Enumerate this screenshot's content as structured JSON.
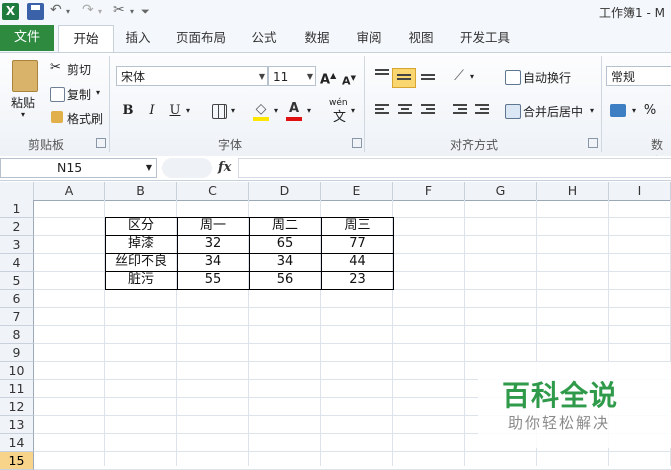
{
  "title": "工作簿1 - M",
  "quick_access": {
    "app_icon": "X",
    "save_icon": "save-icon",
    "undo_icon": "undo-icon",
    "redo_icon": "redo-icon",
    "tools_icon": "scissors-icon",
    "customize_icon": "customize-icon"
  },
  "tabs": [
    "文件",
    "开始",
    "插入",
    "页面布局",
    "公式",
    "数据",
    "审阅",
    "视图",
    "开发工具"
  ],
  "ribbon": {
    "clipboard": {
      "paste": "粘贴",
      "cut": "剪切",
      "copy": "复制",
      "format_painter": "格式刷",
      "group": "剪贴板"
    },
    "font": {
      "name": "宋体",
      "size": "11",
      "bold": "B",
      "italic": "I",
      "underline": "U",
      "wen": "wén",
      "wen_char": "文",
      "group": "字体"
    },
    "alignment": {
      "wrap": "自动换行",
      "merge": "合并后居中",
      "group": "对齐方式"
    },
    "number": {
      "format": "常规",
      "percent": "%",
      "group": "数字"
    }
  },
  "formula_bar": {
    "name_box": "N15",
    "fx": "fx",
    "formula": ""
  },
  "columns": [
    "A",
    "B",
    "C",
    "D",
    "E",
    "F",
    "G",
    "H",
    "I"
  ],
  "rows": [
    "1",
    "2",
    "3",
    "4",
    "5",
    "6",
    "7",
    "8",
    "9",
    "10",
    "11",
    "12",
    "13",
    "14",
    "15"
  ],
  "selected_row": "15",
  "table": {
    "header": [
      "区分",
      "周一",
      "周二",
      "周三"
    ],
    "rows": [
      [
        "掉漆",
        "32",
        "65",
        "77"
      ],
      [
        "丝印不良",
        "34",
        "34",
        "44"
      ],
      [
        "脏污",
        "55",
        "56",
        "23"
      ]
    ]
  },
  "watermark": {
    "title": "百科全说",
    "subtitle": "助你轻松解决"
  },
  "colors": {
    "file_tab": "#2d8a3e",
    "watermark_green": "#2f9b4a",
    "selected_row": "#f7d48a"
  }
}
